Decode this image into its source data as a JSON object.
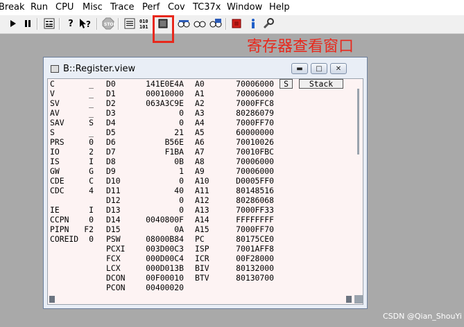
{
  "menu": [
    "Break",
    "Run",
    "CPU",
    "Misc",
    "Trace",
    "Perf",
    "Cov",
    "TC37x",
    "Window",
    "Help"
  ],
  "annotation_text": "寄存器查看窗口",
  "highlight_color": "#e8281c",
  "window": {
    "title": "B::Register.view",
    "buttons": {
      "minimize": "▬",
      "maximize": "□",
      "close": "✕"
    }
  },
  "stack_buttons": {
    "s": "S",
    "stack": "Stack"
  },
  "flags": [
    {
      "name": "C",
      "value": "_"
    },
    {
      "name": "V",
      "value": "_"
    },
    {
      "name": "SV",
      "value": "_"
    },
    {
      "name": "AV",
      "value": "_"
    },
    {
      "name": "SAV",
      "value": "S"
    },
    {
      "name": "S",
      "value": "_"
    },
    {
      "name": "PRS",
      "value": "0"
    },
    {
      "name": "IO",
      "value": "2"
    },
    {
      "name": "IS",
      "value": "I"
    },
    {
      "name": "GW",
      "value": "G"
    },
    {
      "name": "CDE",
      "value": "C"
    },
    {
      "name": "CDC",
      "value": "4"
    },
    {
      "name": "",
      "value": ""
    },
    {
      "name": "IE",
      "value": "I"
    },
    {
      "name": "CCPN",
      "value": "0"
    },
    {
      "name": "PIPN",
      "value": "F2"
    },
    {
      "name": "COREID",
      "value": "0"
    }
  ],
  "data_regs": [
    {
      "name": "D0",
      "value": "141E0E4A"
    },
    {
      "name": "D1",
      "value": "00010000"
    },
    {
      "name": "D2",
      "value": "063A3C9E"
    },
    {
      "name": "D3",
      "value": "0"
    },
    {
      "name": "D4",
      "value": "0"
    },
    {
      "name": "D5",
      "value": "21"
    },
    {
      "name": "D6",
      "value": "B56E"
    },
    {
      "name": "D7",
      "value": "F1BA"
    },
    {
      "name": "D8",
      "value": "0B"
    },
    {
      "name": "D9",
      "value": "1"
    },
    {
      "name": "D10",
      "value": "0"
    },
    {
      "name": "D11",
      "value": "40"
    },
    {
      "name": "D12",
      "value": "0"
    },
    {
      "name": "D13",
      "value": "0"
    },
    {
      "name": "D14",
      "value": "0040800F"
    },
    {
      "name": "D15",
      "value": "0A"
    },
    {
      "name": "PSW",
      "value": "08000B84"
    },
    {
      "name": "PCXI",
      "value": "003D00C3"
    },
    {
      "name": "FCX",
      "value": "000D00C4"
    },
    {
      "name": "LCX",
      "value": "000D013B"
    },
    {
      "name": "DCON",
      "value": "00F00010"
    },
    {
      "name": "PCON",
      "value": "00400020"
    }
  ],
  "addr_regs": [
    {
      "name": "A0",
      "value": "70006000"
    },
    {
      "name": "A1",
      "value": "70006000"
    },
    {
      "name": "A2",
      "value": "7000FFC8"
    },
    {
      "name": "A3",
      "value": "80286079"
    },
    {
      "name": "A4",
      "value": "7000FF70"
    },
    {
      "name": "A5",
      "value": "60000000"
    },
    {
      "name": "A6",
      "value": "70010026"
    },
    {
      "name": "A7",
      "value": "70010FBC"
    },
    {
      "name": "A8",
      "value": "70006000"
    },
    {
      "name": "A9",
      "value": "70006000"
    },
    {
      "name": "A10",
      "value": "D0005FF0"
    },
    {
      "name": "A11",
      "value": "80148516"
    },
    {
      "name": "A12",
      "value": "80286068"
    },
    {
      "name": "A13",
      "value": "7000FF33"
    },
    {
      "name": "A14",
      "value": "FFFFFFFF"
    },
    {
      "name": "A15",
      "value": "7000FF70"
    },
    {
      "name": "PC",
      "value": "80175CE0"
    },
    {
      "name": "ISP",
      "value": "7001AFF8"
    },
    {
      "name": "ICR",
      "value": "00F28000"
    },
    {
      "name": "BIV",
      "value": "80132000"
    },
    {
      "name": "BTV",
      "value": "80130700"
    }
  ],
  "watermark": "CSDN @Qian_ShouYi"
}
